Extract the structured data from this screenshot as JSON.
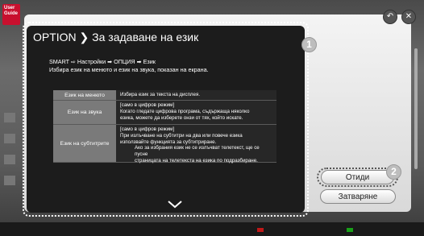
{
  "guide_badge": {
    "line1": "User",
    "line2": "Guide"
  },
  "top_icons": {
    "back": "back-arrow-icon",
    "close": "close-icon"
  },
  "dialog": {
    "title": "OPTION ❯ За задаване на език",
    "path": "SMART ⇨ Настройки ➡ ОПЦИЯ ➡ Език",
    "description": "Избира език на менюто и език на звука, показан на екрана.",
    "rows": [
      {
        "label": "Език на менюто",
        "lines": [
          "Избира език за текста на дисплея."
        ]
      },
      {
        "label": "Език на звука",
        "lines": [
          "[само в цифров режим]",
          "Когато гледате цифрова програма, съдържаща няколко",
          "езика, можете да изберете онзи от тях, който искате."
        ]
      },
      {
        "label": "Език на субтитрите",
        "lines": [
          "[само в цифров режим]",
          "При излъчване на субтитри на два или повече езика",
          "използвайте функцията за субтитриране."
        ],
        "indent_lines": [
          "Ако за избрания език не се излъчват телетекст, ще се пусне",
          "страницата на телетекста на езика по подразбиране."
        ]
      }
    ],
    "scroll_icon": "chevron-down-icon"
  },
  "callouts": {
    "one": "1",
    "two": "2"
  },
  "buttons": {
    "go": "Отиди",
    "close": "Затваряне"
  },
  "colors": {
    "dialog_bg": "#1c1c1c",
    "label_cell": "#7a7a7a",
    "red_key": "#c01818",
    "green_key": "#18a018"
  }
}
